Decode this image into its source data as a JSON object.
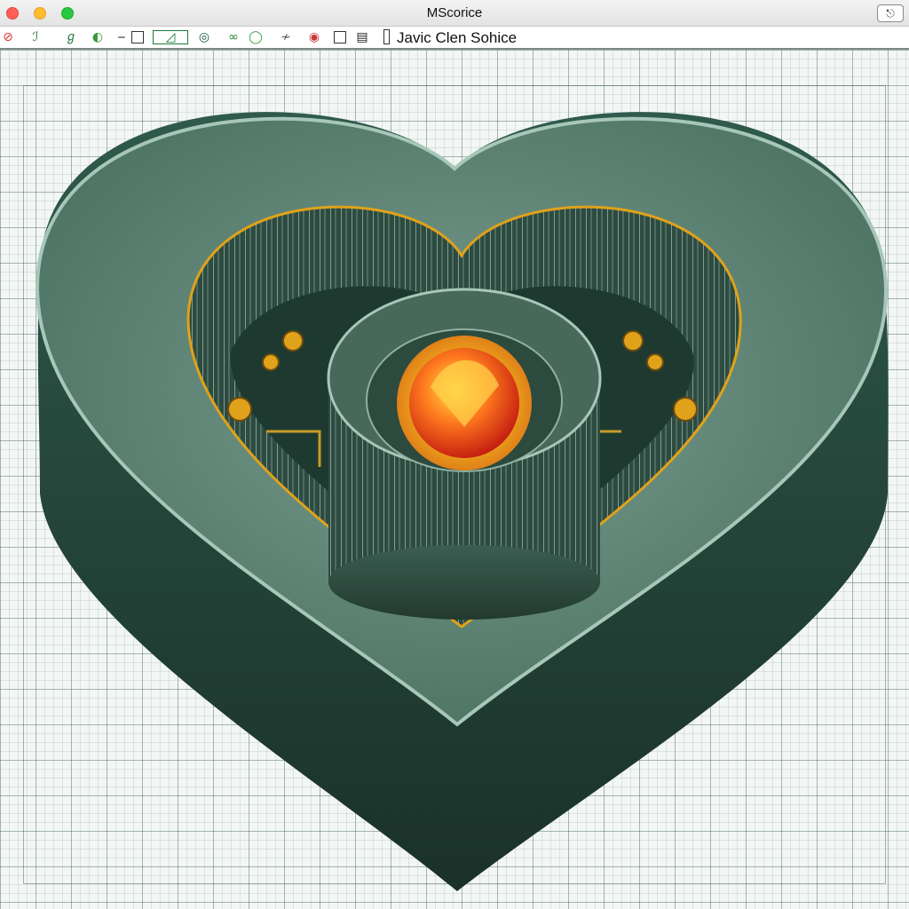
{
  "window": {
    "title": "MScorice",
    "corner_glyph": "⎋"
  },
  "toolbar": {
    "tools": [
      {
        "name": "stop-icon",
        "glyph": "⊘",
        "color": "#d3332b"
      },
      {
        "name": "pen-icon",
        "glyph": "ℐ",
        "color": "#1a6b2f"
      },
      {
        "name": "brush-icon",
        "glyph": "ℊ",
        "color": "#1a7a3a"
      },
      {
        "name": "leaf-icon",
        "glyph": "◐",
        "color": "#3a9a3a"
      },
      {
        "name": "line-icon",
        "glyph": "‒",
        "color": "#222222"
      },
      {
        "name": "square-icon",
        "glyph": "□",
        "color": "#222222"
      },
      {
        "name": "gradient-icon",
        "glyph": "◿",
        "color": "#1a7a3a"
      },
      {
        "name": "target-icon",
        "glyph": "◎",
        "color": "#1a5a3a"
      },
      {
        "name": "link-icon",
        "glyph": "∞",
        "color": "#2a8a3a"
      },
      {
        "name": "circle-icon",
        "glyph": "◯",
        "color": "#3aa03a"
      },
      {
        "name": "curve-icon",
        "glyph": "≁",
        "color": "#555555"
      },
      {
        "name": "eye-icon",
        "glyph": "◉",
        "color": "#c83a3a"
      },
      {
        "name": "checkbox-icon",
        "glyph": "□",
        "color": "#222222"
      },
      {
        "name": "panel-icon",
        "glyph": "▤",
        "color": "#222222"
      }
    ],
    "service_label": "Javic Clen Sohice"
  },
  "colors": {
    "heart_outer": "#557a6c",
    "heart_side": "#24433a",
    "core_glow": "#ff4a1c",
    "accent": "#e0a21a"
  }
}
